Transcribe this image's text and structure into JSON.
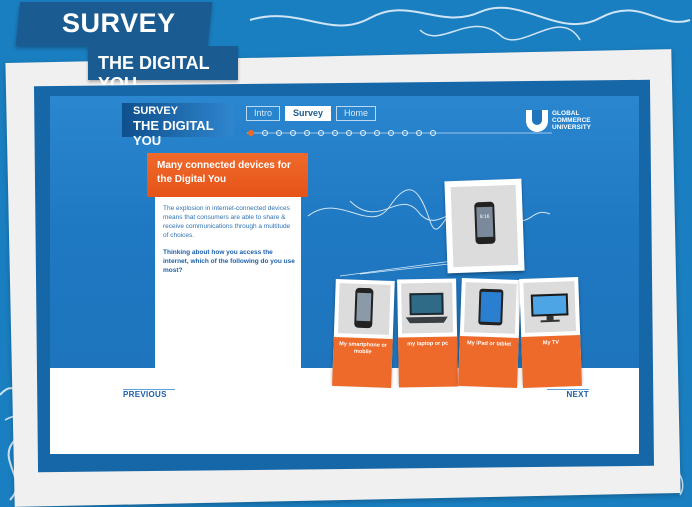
{
  "header": {
    "survey_tag": "SURVEY",
    "digital_tag": "THE DIGITAL YOU"
  },
  "screen": {
    "title_small": "SURVEY",
    "title_big": "THE DIGITAL YOU",
    "tabs": [
      {
        "label": "Intro",
        "active": false
      },
      {
        "label": "Survey",
        "active": true
      },
      {
        "label": "Home",
        "active": false
      }
    ],
    "brand": {
      "name_line1": "GLOBAL",
      "name_line2": "COMMERCE",
      "name_line3": "UNIVERSITY"
    },
    "question": {
      "heading": "Many connected devices for the Digital You",
      "intro": "The explosion in internet-connected devices means that consumers are able to share & receive communications through a multitude of choices.",
      "prompt": "Thinking about how you access the internet, which of the following do you use most?"
    },
    "options": [
      {
        "label": "My smartphone or mobile",
        "icon": "smartphone-icon"
      },
      {
        "label": "my laptop or pc",
        "icon": "laptop-icon"
      },
      {
        "label": "My iPad or tablet",
        "icon": "tablet-icon"
      },
      {
        "label": "My TV",
        "icon": "tv-icon"
      }
    ],
    "nav": {
      "previous": "PREVIOUS",
      "next": "NEXT"
    }
  },
  "colors": {
    "background": "#1a7fc1",
    "accent": "#ee6a2b",
    "panel_blue": "#1e75bd",
    "tag_blue": "#1a5c92"
  }
}
